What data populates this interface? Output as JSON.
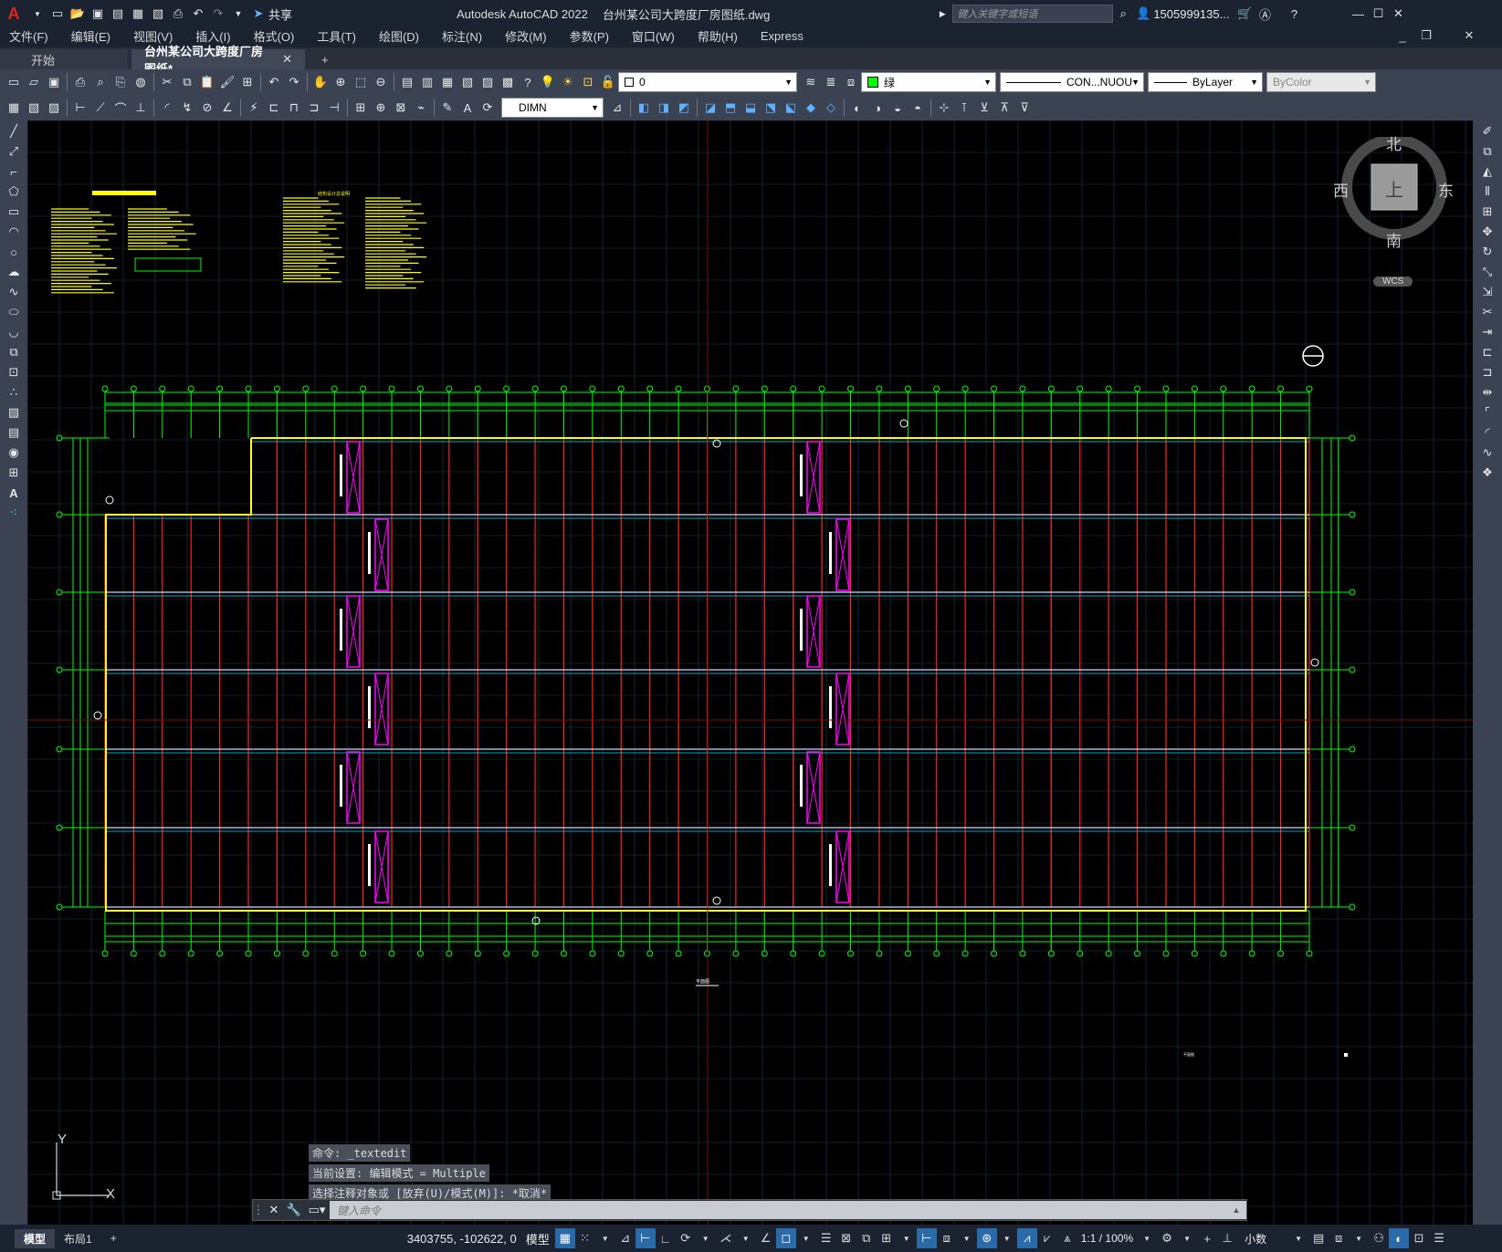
{
  "titlebar": {
    "app_title": "Autodesk AutoCAD 2022",
    "file_title": "台州某公司大跨度厂房图纸.dwg",
    "share_label": "共享",
    "search_placeholder": "键入关键字或短语",
    "user_label": "1505999135..."
  },
  "menubar": {
    "items": [
      "文件(F)",
      "编辑(E)",
      "视图(V)",
      "插入(I)",
      "格式(O)",
      "工具(T)",
      "绘图(D)",
      "标注(N)",
      "修改(M)",
      "参数(P)",
      "窗口(W)",
      "帮助(H)",
      "Express"
    ]
  },
  "tabs": {
    "start": "开始",
    "drawing": "台州某公司大跨度厂房图纸*",
    "add": "+"
  },
  "toolbar": {
    "layer_value": "0",
    "color_value": "绿",
    "linetype_value": "CON...NUOU",
    "lineweight_value": "ByLayer",
    "plotstyle_value": "ByColor",
    "dimstyle_value": "DIMN"
  },
  "viewcube": {
    "north": "北",
    "south": "南",
    "east": "东",
    "west": "西",
    "top": "上",
    "wcs": "WCS"
  },
  "drawing": {
    "plan_caption": "平面图",
    "plan_caption2": "平面图",
    "notes_title": "结构设计总说明",
    "ucs_x": "X",
    "ucs_y": "Y",
    "colors": {
      "grid": "#1f3b4a",
      "green": "#00ff00",
      "red": "#ff2020",
      "yellow": "#ffff00",
      "magenta": "#ff00ff",
      "cyan": "#00e0ff"
    }
  },
  "command": {
    "history": [
      "命令:  _textedit",
      "当前设置: 编辑模式 = Multiple",
      "选择注释对象或 [放弃(U)/模式(M)]: *取消*"
    ],
    "placeholder": "键入命令"
  },
  "status": {
    "layout_tabs": [
      "模型",
      "布局1"
    ],
    "add_tab": "+",
    "coords": "3403755, -102622, 0",
    "model_label": "模型",
    "scale": "1:1 / 100%",
    "units": "小数"
  }
}
